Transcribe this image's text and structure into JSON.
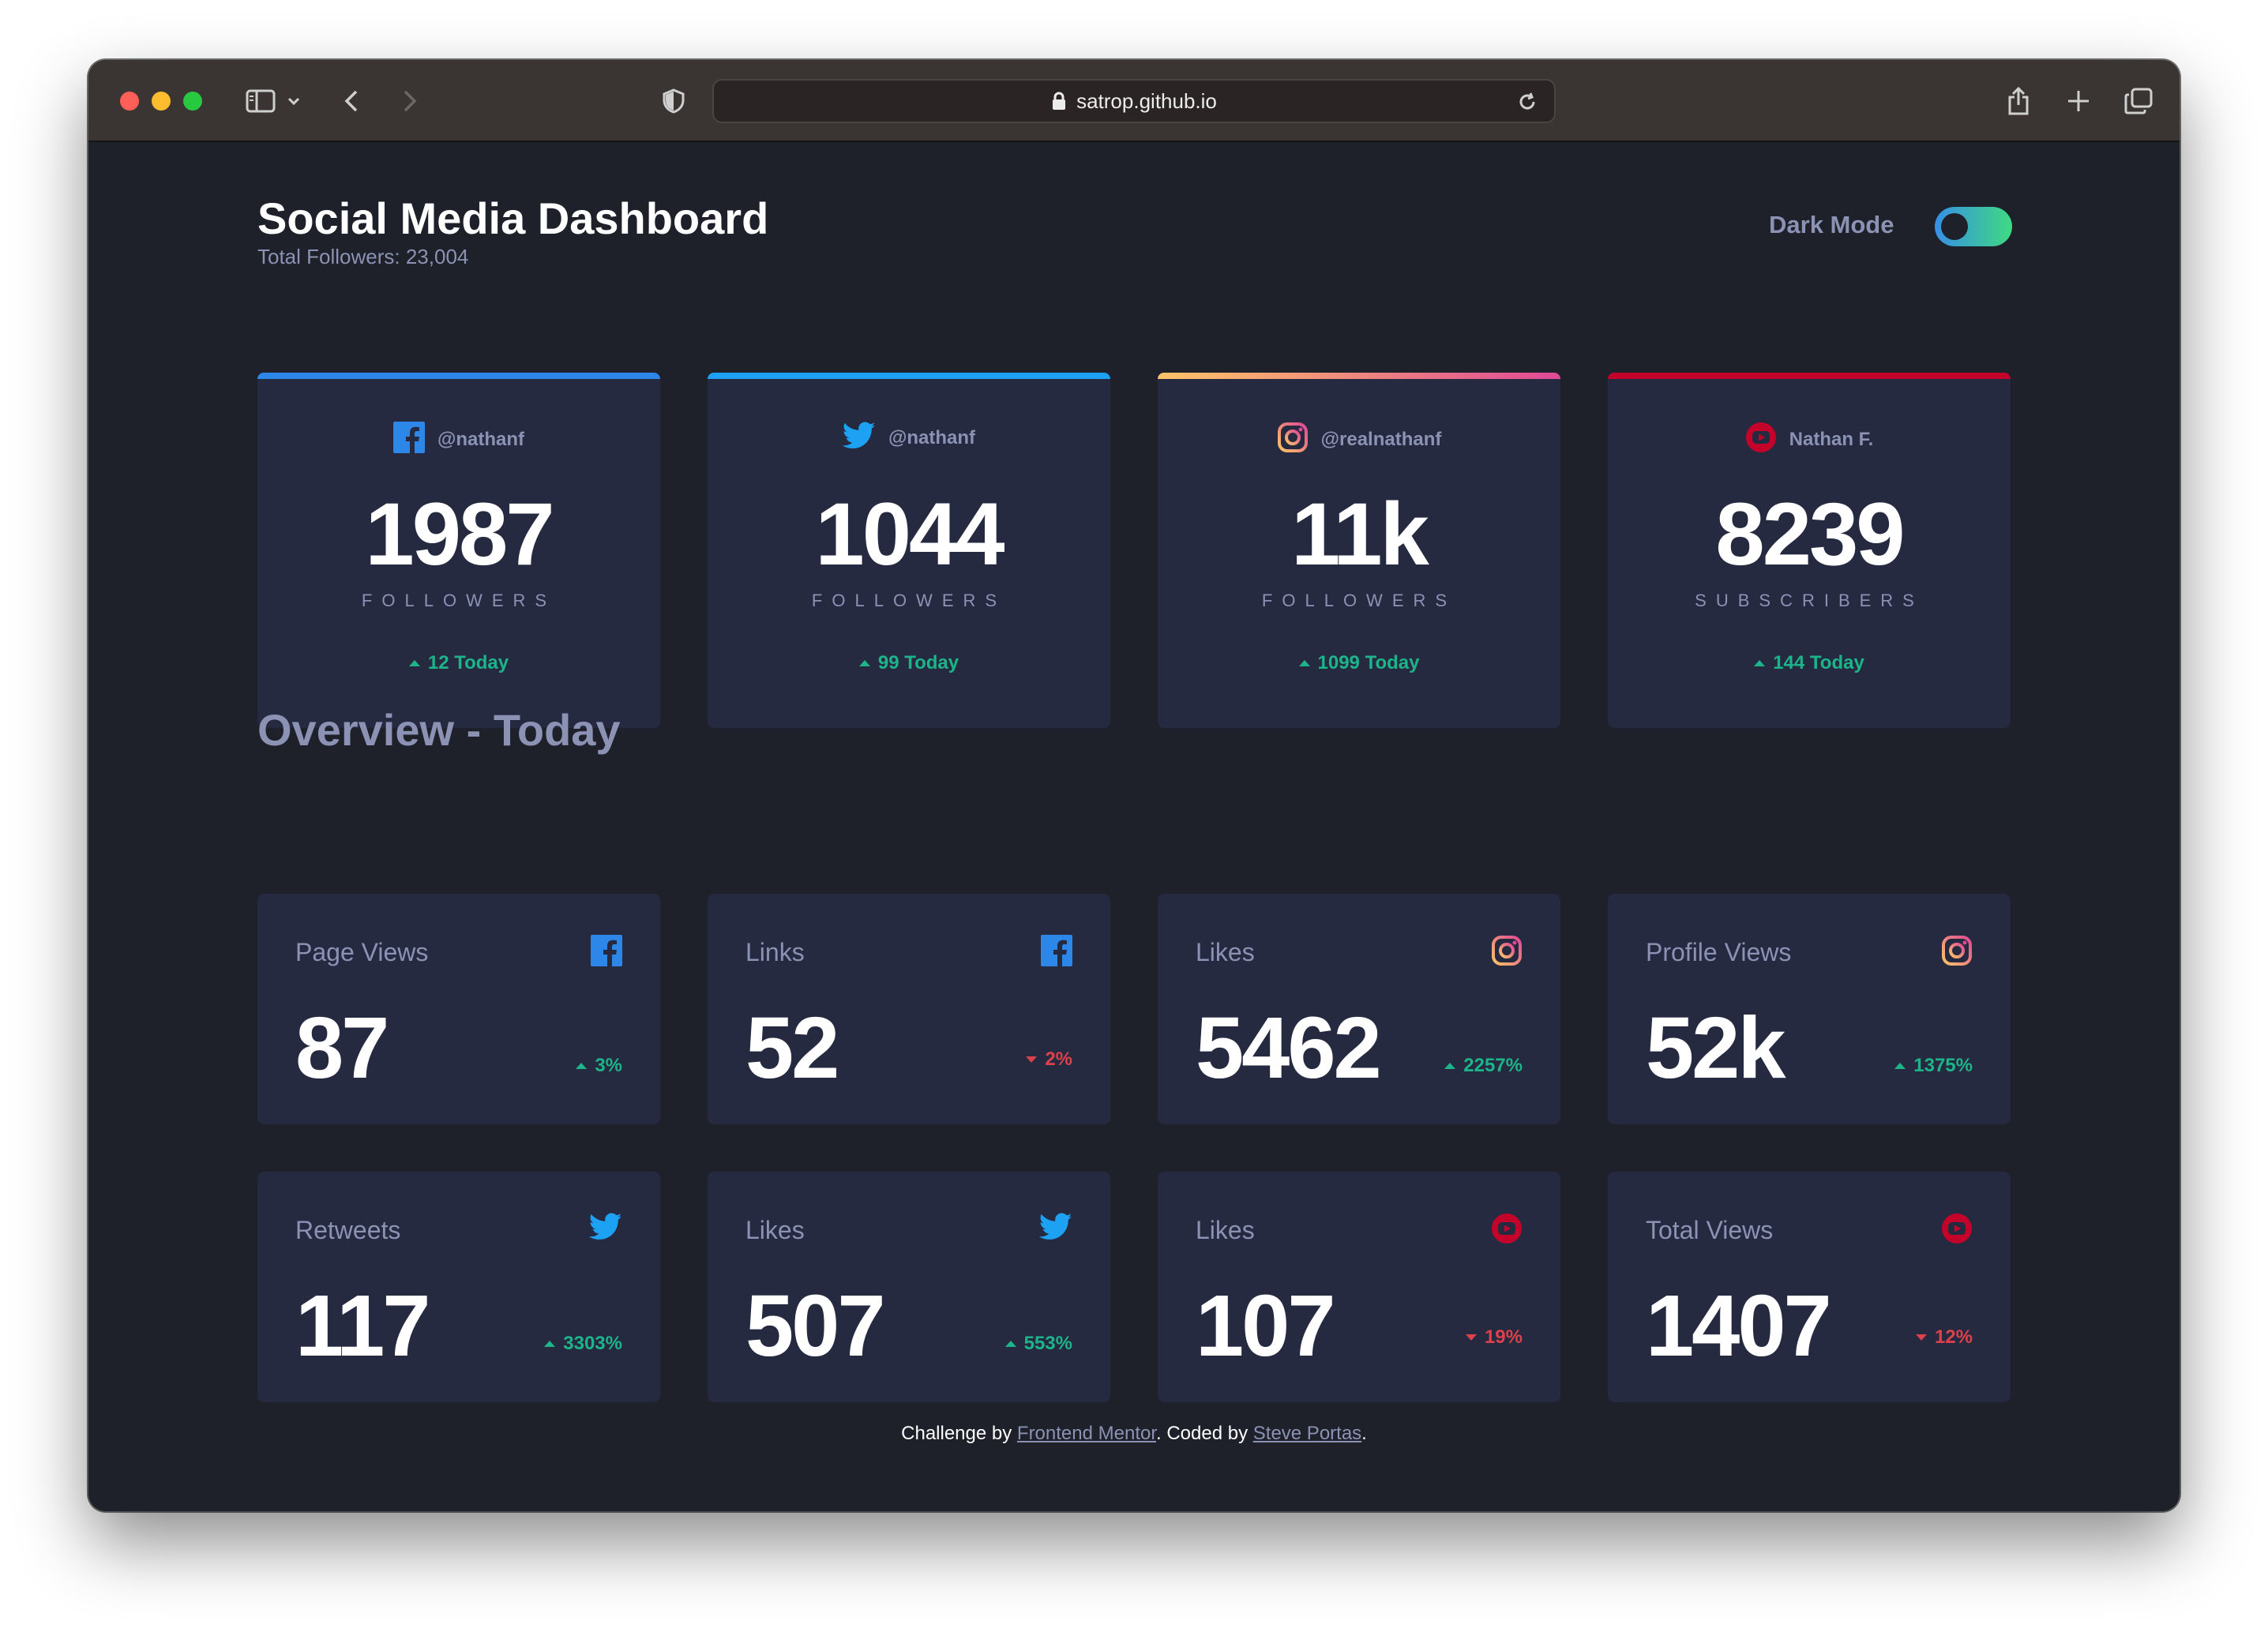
{
  "browser": {
    "url": "satrop.github.io"
  },
  "header": {
    "title": "Social Media Dashboard",
    "subtitle": "Total Followers: 23,004",
    "mode_label": "Dark Mode",
    "toggle_on": true
  },
  "followers": [
    {
      "platform": "facebook",
      "handle": "@nathanf",
      "count": "1987",
      "label": "FOLLOWERS",
      "today": "12 Today",
      "accent": "#2c87e9"
    },
    {
      "platform": "twitter",
      "handle": "@nathanf",
      "count": "1044",
      "label": "FOLLOWERS",
      "today": "99 Today",
      "accent": "#1da1f2"
    },
    {
      "platform": "instagram",
      "handle": "@realnathanf",
      "count": "11k",
      "label": "FOLLOWERS",
      "today": "1099 Today",
      "accent": "#df8a54"
    },
    {
      "platform": "youtube",
      "handle": "Nathan F.",
      "count": "8239",
      "label": "SUBSCRIBERS",
      "today": "144 Today",
      "accent": "#c4032a"
    }
  ],
  "overview": {
    "title": "Overview - Today",
    "cards": [
      {
        "label": "Page Views",
        "platform": "facebook",
        "value": "87",
        "change": "3%",
        "direction": "up"
      },
      {
        "label": "Links",
        "platform": "facebook",
        "value": "52",
        "change": "2%",
        "direction": "down"
      },
      {
        "label": "Likes",
        "platform": "instagram",
        "value": "5462",
        "change": "2257%",
        "direction": "up"
      },
      {
        "label": "Profile Views",
        "platform": "instagram",
        "value": "52k",
        "change": "1375%",
        "direction": "up"
      },
      {
        "label": "Retweets",
        "platform": "twitter",
        "value": "117",
        "change": "3303%",
        "direction": "up"
      },
      {
        "label": "Likes",
        "platform": "twitter",
        "value": "507",
        "change": "553%",
        "direction": "up"
      },
      {
        "label": "Likes",
        "platform": "youtube",
        "value": "107",
        "change": "19%",
        "direction": "down"
      },
      {
        "label": "Total Views",
        "platform": "youtube",
        "value": "1407",
        "change": "12%",
        "direction": "down"
      }
    ]
  },
  "footer": {
    "prefix": "Challenge by ",
    "link1": "Frontend Mentor",
    "middle": ". Coded by ",
    "link2": "Steve Portas",
    "suffix": "."
  },
  "colors": {
    "background": "#1e202a",
    "card": "#252a41",
    "muted_text": "#8c92b3",
    "up": "#1db489",
    "down": "#dc414c"
  }
}
